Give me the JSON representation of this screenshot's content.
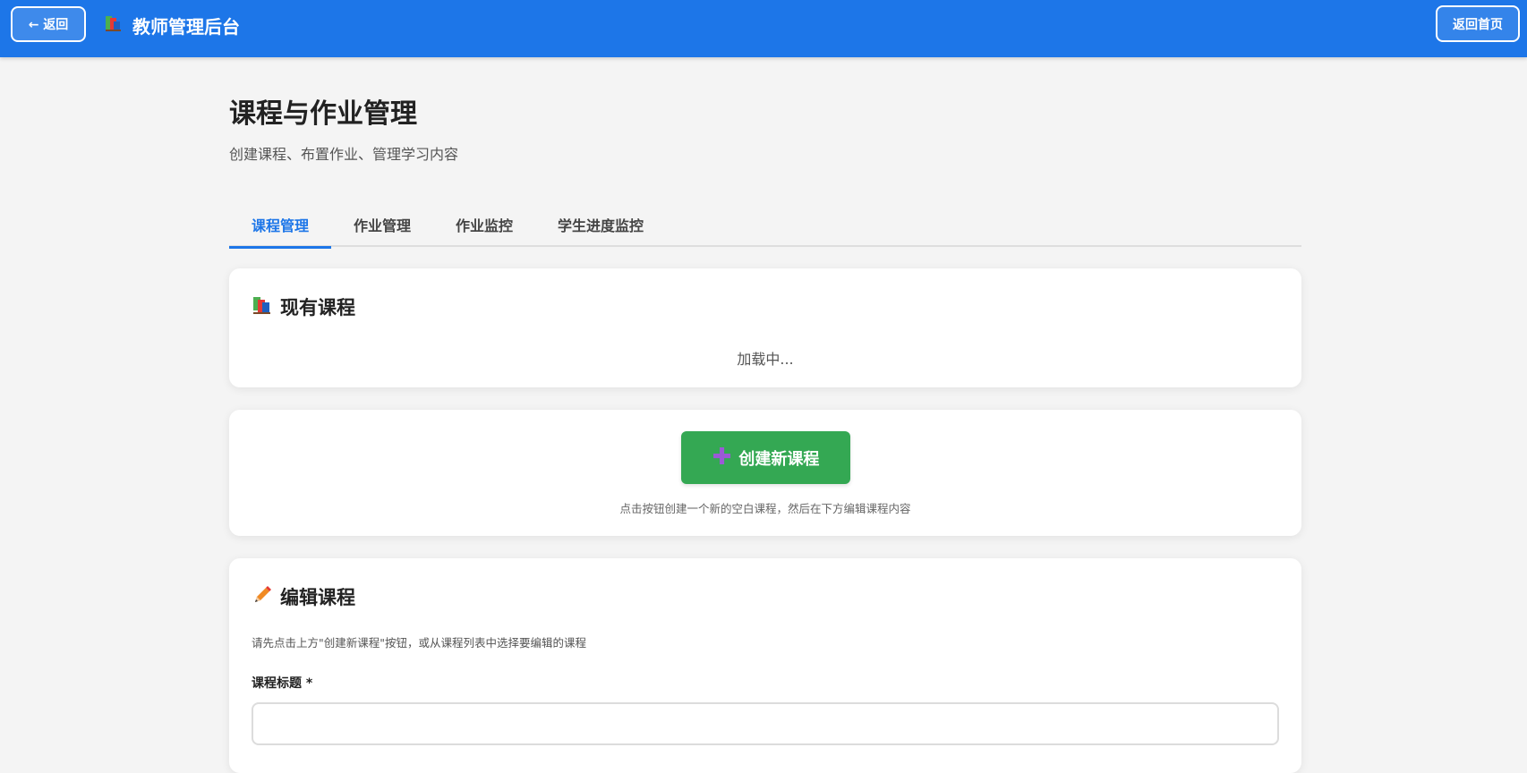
{
  "header": {
    "back_label": "← 返回",
    "brand_icon": "books-icon",
    "title": "教师管理后台",
    "home_label": "返回首页",
    "bg_color": "#1d76e8"
  },
  "page": {
    "title": "课程与作业管理",
    "subtitle": "创建课程、布置作业、管理学习内容"
  },
  "tabs": [
    {
      "label": "课程管理",
      "active": true
    },
    {
      "label": "作业管理",
      "active": false
    },
    {
      "label": "作业监控",
      "active": false
    },
    {
      "label": "学生进度监控",
      "active": false
    }
  ],
  "existing_courses": {
    "icon": "books-icon",
    "heading": "现有课程",
    "status": "加载中..."
  },
  "create_course": {
    "button_icon": "plus-icon",
    "button_label": "创建新课程",
    "hint": "点击按钮创建一个新的空白课程，然后在下方编辑课程内容",
    "button_color": "#34a853"
  },
  "edit_course": {
    "icon": "pencil-icon",
    "heading": "编辑课程",
    "hint": "请先点击上方\"创建新课程\"按钮，或从课程列表中选择要编辑的课程",
    "title_field_label": "课程标题 *",
    "title_field_value": ""
  }
}
